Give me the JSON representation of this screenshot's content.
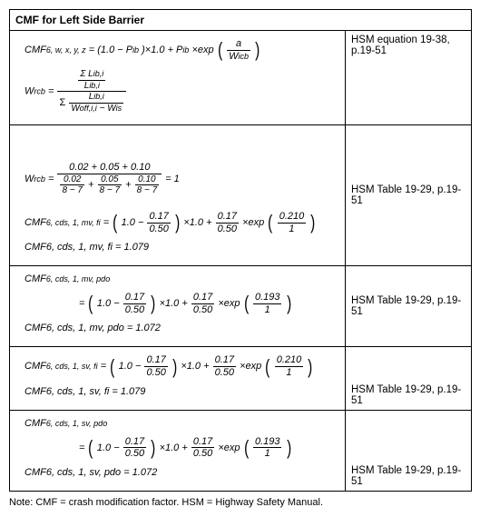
{
  "title": "CMF for Left Side Barrier",
  "ref_a": "HSM equation 19-38, p.19-51",
  "ref_b": "HSM Table 19-29, p.19-51",
  "ref_c": "HSM Table 19-29, p.19-51",
  "ref_d": "HSM Table 19-29, p.19-51",
  "ref_e": "HSM Table 19-29, p.19-51",
  "gen_cmf_lhs": "CMF",
  "gen_cmf_sub": "6, w, x, y, z",
  "gen_cmf_rhs_a": " = (1.0 − P",
  "gen_P_sub": "ib",
  "gen_cmf_rhs_b": ")×1.0 + P",
  "gen_cmf_rhs_c": "×exp",
  "gen_exp_num": "a",
  "gen_exp_den_a": "W",
  "gen_exp_den_sub": "icb",
  "wrcb_lhs": "W",
  "wrcb_sub": "rcb",
  "wrcb_num_top1": "Σ L",
  "wrcb_num_top_sub": "ib,i",
  "wrcb_num_bot1": "L",
  "wrcb_den_top1": "L",
  "wrcb_den_bot1": "W",
  "wrcb_den_bot1_sub": "off,i,i",
  "wrcb_den_bot_minus": " − W",
  "wrcb_den_bot_minus_sub": "is",
  "sigma": "Σ",
  "wrcb2_num": "0.02 + 0.05 + 0.10",
  "wrcb2_d1n": "0.02",
  "wrcb2_d1d": "8 − 7",
  "wrcb2_d2n": "0.05",
  "wrcb2_d2d": "8 − 7",
  "wrcb2_d3n": "0.10",
  "wrcb2_d3d": "8 − 7",
  "wrcb2_result": " = 1",
  "line1_sub": "6, cds, 1, mv, fi",
  "line1_valA": "0.17",
  "line1_valB": "0.50",
  "line1_valC": "0.17",
  "line1_valD": "0.50",
  "line1_expN": "0.210",
  "line1_expD": "1",
  "line1_res": " = 1.079",
  "line2_sub": "6, cds, 1, mv, pdo",
  "line2_expN": "0.193",
  "line2_expD": "1",
  "line2_res": " = 1.072",
  "line3_sub": "6, cds, 1, sv, fi",
  "line3_expN": "0.210",
  "line3_res": " = 1.079",
  "line4_sub": "6, cds, 1, sv, pdo",
  "line4_expN": "0.193",
  "line4_res": " = 1.072",
  "note": "Note: CMF = crash modification factor. HSM = Highway Safety Manual."
}
